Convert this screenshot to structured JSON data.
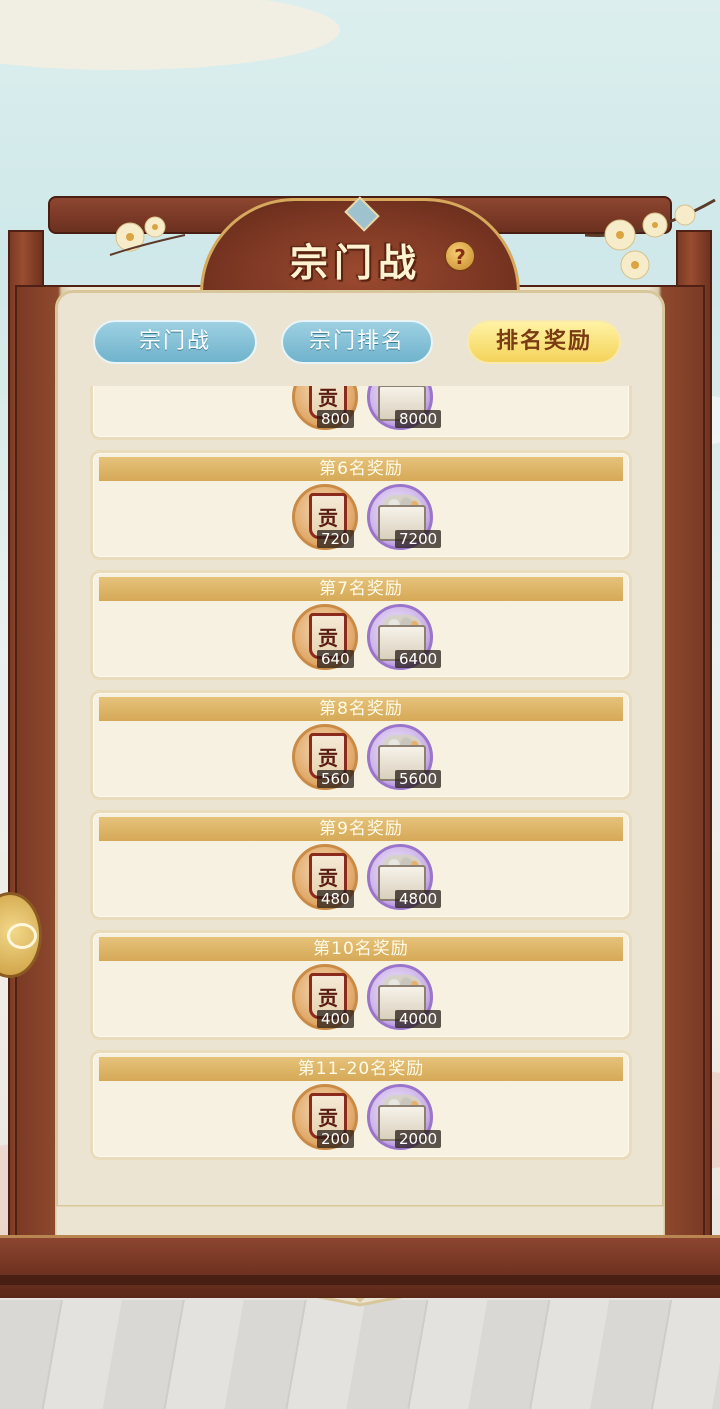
{
  "header": {
    "title": "宗门战",
    "help_icon": "?"
  },
  "tabs": [
    {
      "label": "宗门战",
      "active": false
    },
    {
      "label": "宗门排名",
      "active": false
    },
    {
      "label": "排名奖励",
      "active": true
    }
  ],
  "reward_item_names": [
    "contribution-banner-icon",
    "silver-chest-icon"
  ],
  "rewards": [
    {
      "title": "",
      "contribution": "800",
      "silver": "8000"
    },
    {
      "title": "第6名奖励",
      "contribution": "720",
      "silver": "7200"
    },
    {
      "title": "第7名奖励",
      "contribution": "640",
      "silver": "6400"
    },
    {
      "title": "第8名奖励",
      "contribution": "560",
      "silver": "5600"
    },
    {
      "title": "第9名奖励",
      "contribution": "480",
      "silver": "4800"
    },
    {
      "title": "第10名奖励",
      "contribution": "400",
      "silver": "4000"
    },
    {
      "title": "第11-20名奖励",
      "contribution": "200",
      "silver": "2000"
    }
  ],
  "banner_glyph": "贡",
  "colors": {
    "board_wood": "#7b3a25",
    "tab_active": "#f4d35a",
    "tab_inactive": "#6fb3cc",
    "card_head": "#d5a957"
  }
}
